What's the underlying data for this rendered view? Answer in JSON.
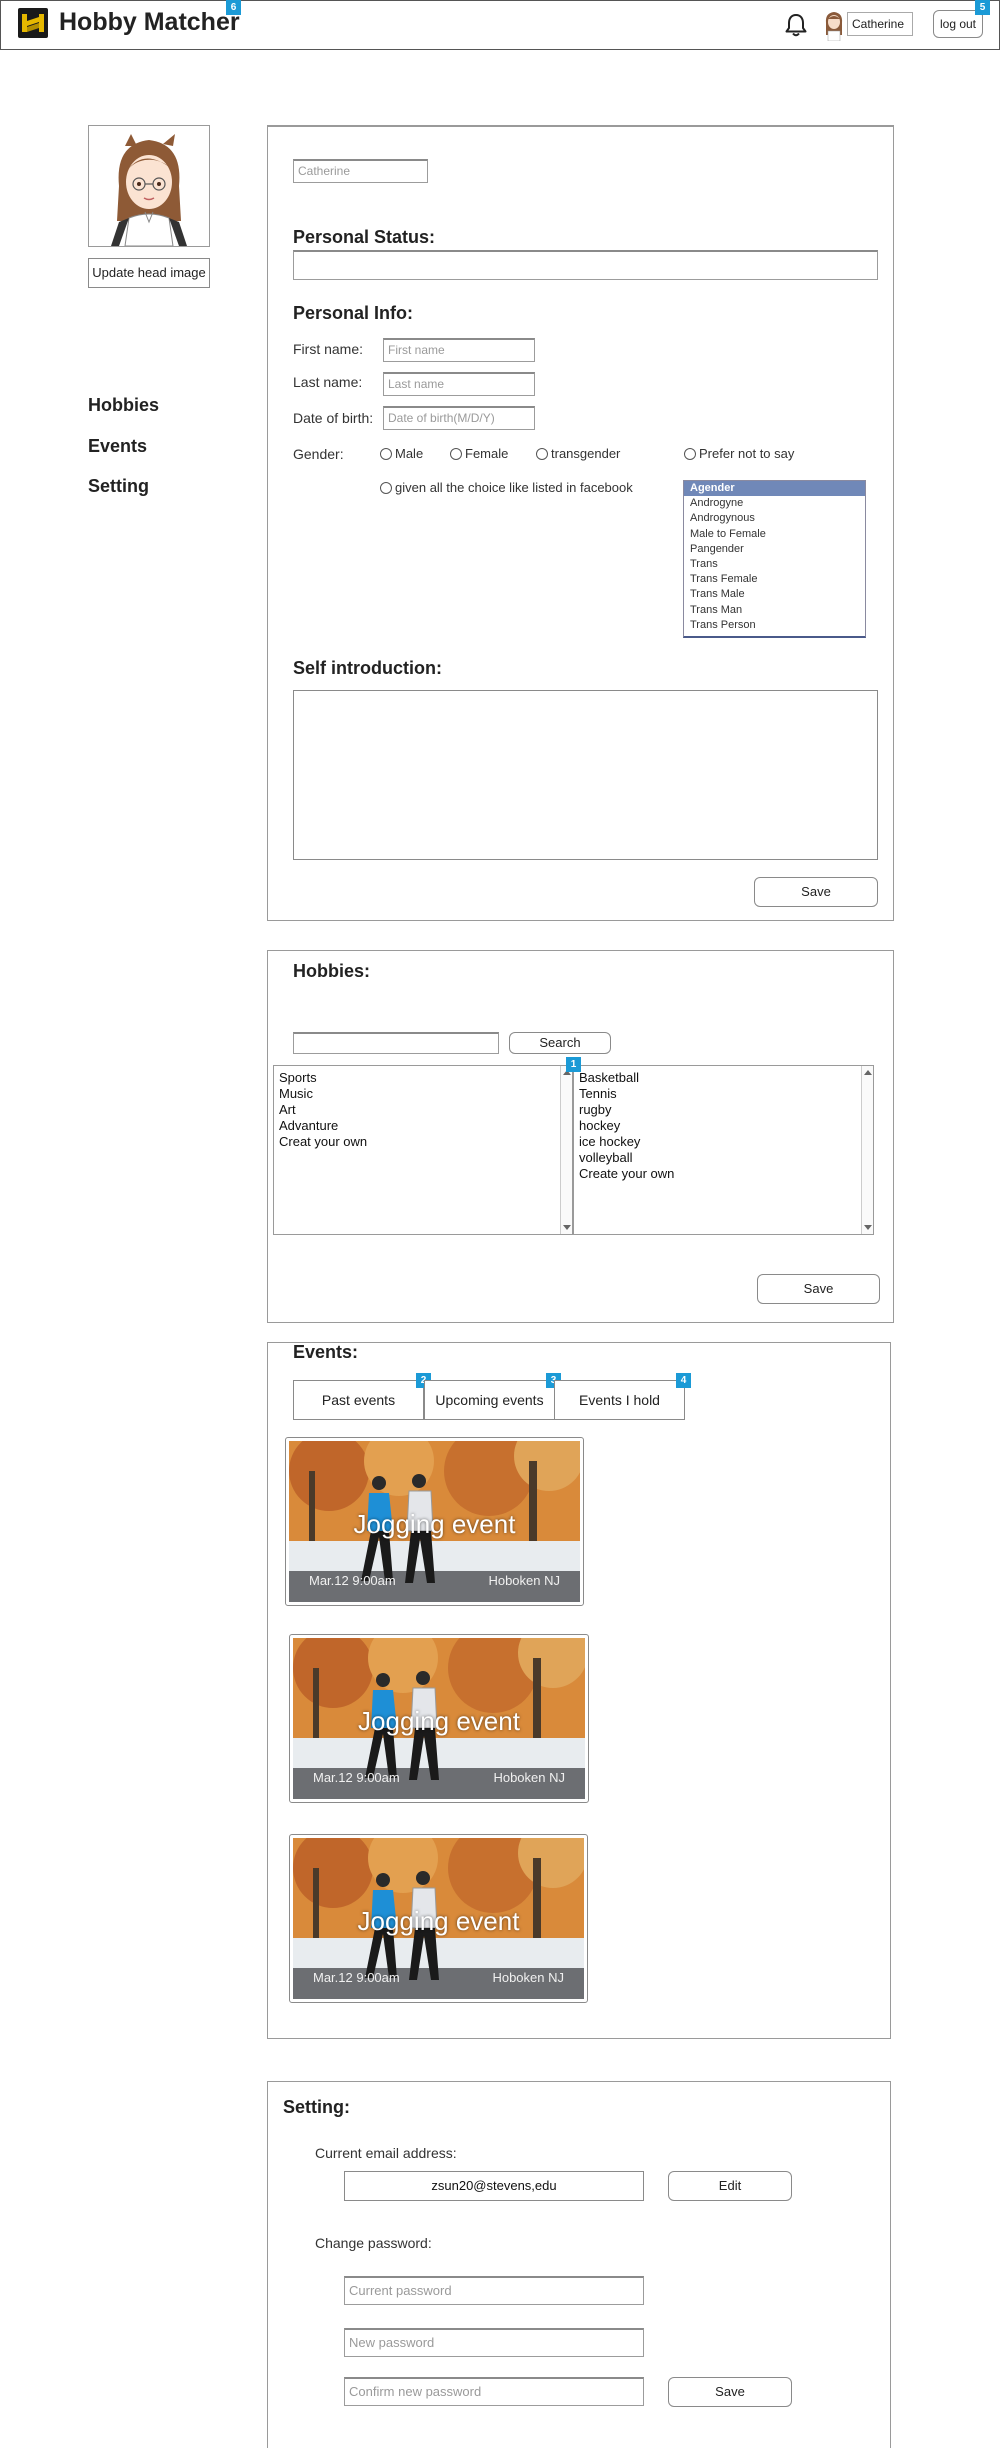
{
  "header": {
    "app_title": "Hobby Matcher",
    "title_badge": "6",
    "user_name": "Catherine",
    "logout_label": "log out",
    "logout_badge": "5",
    "icons": {
      "logo": "logo-icon",
      "bell": "bell-icon",
      "avatar": "avatar"
    }
  },
  "profile": {
    "update_image_label": "Update head image"
  },
  "sidebar": {
    "items": [
      {
        "label": "Hobbies"
      },
      {
        "label": "Events"
      },
      {
        "label": "Setting"
      }
    ]
  },
  "info": {
    "username_placeholder": "Catherine",
    "personal_status_heading": "Personal Status:",
    "personal_status_value": "",
    "personal_info_heading": "Personal Info:",
    "first_name_label": "First name:",
    "first_name_placeholder": "First name",
    "last_name_label": "Last name:",
    "last_name_placeholder": "Last name",
    "dob_label": "Date of birth:",
    "dob_placeholder": "Date of birth(M/D/Y)",
    "gender_label": "Gender:",
    "gender_options": [
      "Male",
      "Female",
      "transgender",
      "Prefer not to say",
      "given all the choice like listed in facebook"
    ],
    "gender_list": [
      "Agender",
      "Androgyne",
      "Androgynous",
      "Male to Female",
      "Pangender",
      "Trans",
      "Trans Female",
      "Trans Male",
      "Trans Man",
      "Trans Person"
    ],
    "gender_list_selected": "Agender",
    "self_intro_heading": "Self introduction:",
    "self_intro_value": "",
    "save_label": "Save"
  },
  "hobbies": {
    "heading": "Hobbies:",
    "search_value": "",
    "search_label": "Search",
    "categories": [
      "Sports",
      "Music",
      "Art",
      "Advanture",
      "Creat your own"
    ],
    "subitems_badge": "1",
    "subitems": [
      "Basketball",
      "Tennis",
      "rugby",
      "hockey",
      "ice hockey",
      "volleyball",
      "Create your own"
    ],
    "save_label": "Save"
  },
  "events": {
    "heading": "Events:",
    "tabs": [
      {
        "label": "Past events",
        "badge": "2"
      },
      {
        "label": "Upcoming events",
        "badge": "3"
      },
      {
        "label": "Events I hold",
        "badge": "4"
      }
    ],
    "cards": [
      {
        "title": "Jogging event",
        "date": "Mar.12 9:00am",
        "location": "Hoboken NJ"
      },
      {
        "title": "Jogging event",
        "date": "Mar.12 9:00am",
        "location": "Hoboken NJ"
      },
      {
        "title": "Jogging event",
        "date": "Mar.12 9:00am",
        "location": "Hoboken NJ"
      }
    ]
  },
  "setting": {
    "heading": "Setting:",
    "email_label": "Current email address:",
    "email_value": "zsun20@stevens,edu",
    "edit_label": "Edit",
    "password_label": "Change password:",
    "current_password_placeholder": "Current password",
    "new_password_placeholder": "New password",
    "confirm_password_placeholder": "Confirm new password",
    "save_label": "Save"
  },
  "colors": {
    "badge": "#1b9ad6",
    "border": "#9a9a9a",
    "list_selected": "#7088b8"
  }
}
